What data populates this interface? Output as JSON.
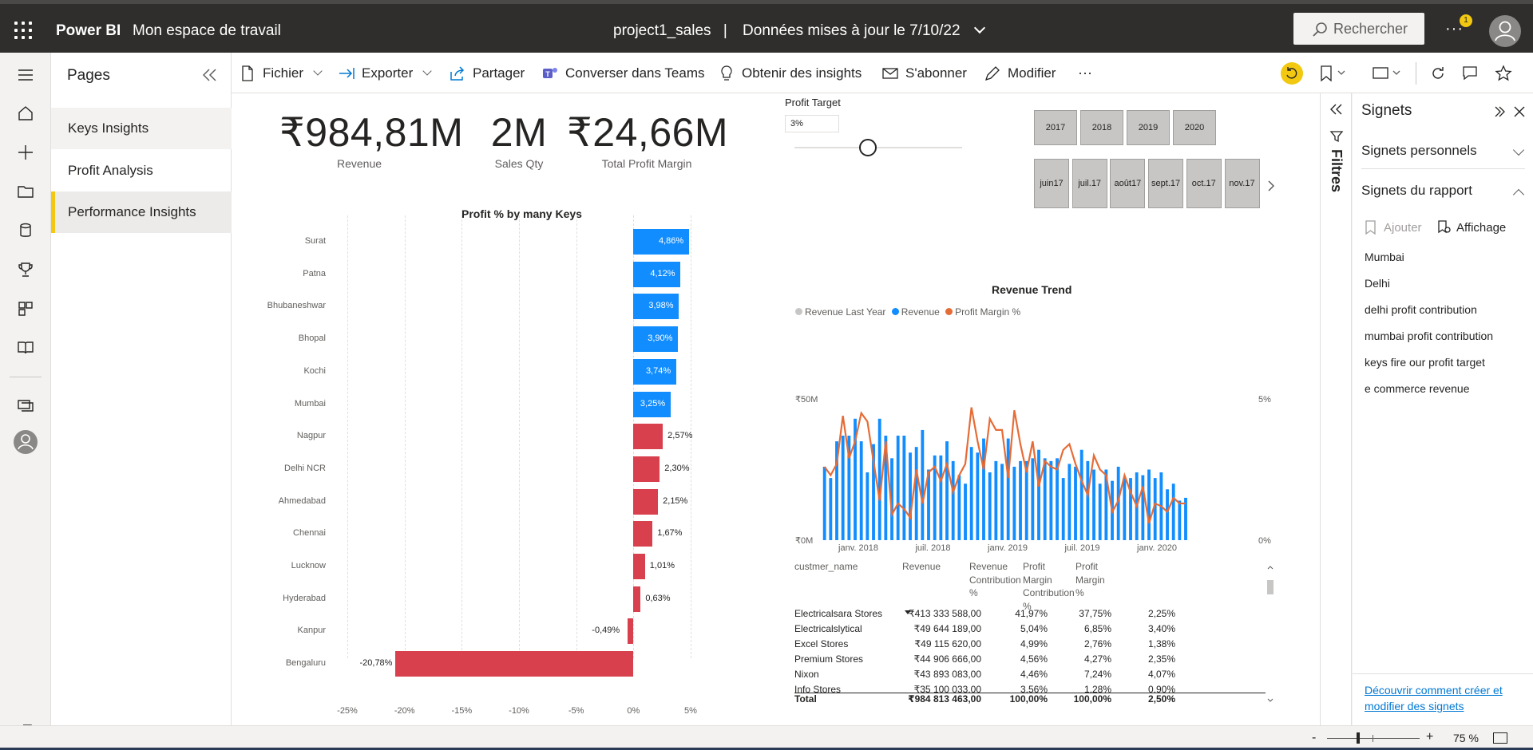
{
  "topbar": {
    "brand": "Power BI",
    "workspace": "Mon espace de travail",
    "report_name": "project1_sales",
    "separator": "|",
    "updated": "Données mises à jour le 7/10/22",
    "search_placeholder": "Rechercher",
    "more": "···",
    "notif_count": "1"
  },
  "pages": {
    "title": "Pages",
    "items": [
      {
        "label": "Keys Insights"
      },
      {
        "label": "Profit Analysis"
      },
      {
        "label": "Performance Insights"
      }
    ],
    "selected_index": 2
  },
  "actions": {
    "file": "Fichier",
    "export": "Exporter",
    "share": "Partager",
    "teams": "Converser dans Teams",
    "insights": "Obtenir des insights",
    "subscribe": "S'abonner",
    "edit": "Modifier",
    "more": "···"
  },
  "kpis": [
    {
      "value": "₹984,81M",
      "label": "Revenue"
    },
    {
      "value": "2M",
      "label": "Sales Qty"
    },
    {
      "value": "₹24,66M",
      "label": "Total Profit Margin"
    }
  ],
  "profit_target": {
    "title": "Profit Target",
    "value": "3%",
    "slider_fraction": 0.44
  },
  "year_tiles": [
    "2017",
    "2018",
    "2019",
    "2020"
  ],
  "month_tiles": [
    {
      "m": "juin",
      "y": "17"
    },
    {
      "m": "juil.",
      "y": "17"
    },
    {
      "m": "août",
      "y": "17"
    },
    {
      "m": "sept.",
      "y": "17"
    },
    {
      "m": "oct.",
      "y": "17"
    },
    {
      "m": "nov.",
      "y": "17"
    }
  ],
  "chart_data": [
    {
      "type": "bar",
      "title": "Profit % by many Keys",
      "orientation": "horizontal",
      "categories": [
        "Surat",
        "Patna",
        "Bhubaneshwar",
        "Bhopal",
        "Kochi",
        "Mumbai",
        "Nagpur",
        "Delhi NCR",
        "Ahmedabad",
        "Chennai",
        "Lucknow",
        "Hyderabad",
        "Kanpur",
        "Bengaluru"
      ],
      "values": [
        4.86,
        4.12,
        3.98,
        3.9,
        3.74,
        3.25,
        2.57,
        2.3,
        2.15,
        1.67,
        1.01,
        0.63,
        -0.49,
        -20.78
      ],
      "labels": [
        "4,86%",
        "4,12%",
        "3,98%",
        "3,90%",
        "3,74%",
        "3,25%",
        "2,57%",
        "2,30%",
        "2,15%",
        "1,67%",
        "1,01%",
        "0,63%",
        "-0,49%",
        "-20,78%"
      ],
      "above_target": [
        true,
        true,
        true,
        true,
        true,
        true,
        false,
        false,
        false,
        false,
        false,
        false,
        false,
        false
      ],
      "colors": {
        "above": "#118dff",
        "below": "#d9404e"
      },
      "xlim": [
        -25,
        5
      ],
      "xticks": [
        "-25%",
        "-20%",
        "-15%",
        "-10%",
        "-5%",
        "0%",
        "5%"
      ]
    },
    {
      "type": "bar+line",
      "title": "Revenue Trend",
      "legend": [
        "Revenue Last Year",
        "Revenue",
        "Profit Margin %"
      ],
      "legend_colors": [
        "#c8c6c4",
        "#118dff",
        "#e66c37"
      ],
      "y_left_ticks": [
        "₹50M",
        "₹0M"
      ],
      "y_right_ticks": [
        "5%",
        "0%"
      ],
      "x_ticks": [
        "janv. 2018",
        "juil. 2018",
        "janv. 2019",
        "juil. 2019",
        "janv. 2020"
      ],
      "ylim_left": [
        0,
        50
      ],
      "ylim_right": [
        0,
        5
      ],
      "revenue_last_year": [
        0,
        0,
        0,
        0,
        0,
        0,
        0,
        0,
        0,
        0,
        0,
        0,
        0,
        0,
        0,
        0,
        0,
        0,
        0,
        0,
        0,
        0,
        0,
        0,
        0,
        0,
        0,
        0,
        0,
        0,
        0,
        0,
        0,
        0,
        0,
        0,
        0,
        0,
        0,
        0,
        0,
        0,
        0,
        0,
        0,
        0,
        0,
        0,
        0,
        0,
        0,
        0,
        0,
        0,
        0,
        0,
        0,
        0,
        0,
        0
      ],
      "revenue": [
        26,
        22,
        35,
        37,
        37,
        43,
        35,
        24,
        34,
        43,
        37,
        29,
        37,
        37,
        31,
        33,
        39,
        25,
        30,
        30,
        35,
        28,
        23,
        20,
        33,
        31,
        36,
        24,
        28,
        27,
        36,
        26,
        28,
        28,
        29,
        32,
        29,
        28,
        29,
        22,
        27,
        26,
        32,
        28,
        25,
        20,
        25,
        21,
        26,
        22,
        22,
        24,
        23,
        25,
        22,
        24,
        18,
        20,
        14,
        15
      ],
      "profit_margin_pct": [
        2.6,
        2.3,
        2.7,
        4.4,
        2.9,
        3.5,
        4.5,
        4.2,
        2.8,
        1.4,
        3.5,
        0.9,
        1.3,
        1.1,
        0.8,
        2.5,
        1.3,
        2.4,
        2.6,
        2.1,
        2.7,
        1.7,
        2.3,
        2.7,
        4.7,
        3.5,
        2.5,
        4.3,
        3.9,
        3.9,
        2.2,
        4.6,
        3.4,
        2.4,
        3.5,
        1.9,
        2.8,
        2.6,
        2.5,
        3.2,
        3.4,
        2.7,
        2.1,
        1.6,
        3.0,
        2.5,
        2.3,
        1.0,
        1.4,
        2.3,
        1.7,
        1.2,
        1.9,
        0.6,
        1.3,
        1.2,
        1.0,
        1.5,
        1.3,
        1.3
      ]
    }
  ],
  "table": {
    "headers": [
      "custmer_name",
      "Revenue",
      "Revenue Contribution %",
      "Profit Margin Contribution %",
      "Profit Margin %"
    ],
    "rows": [
      [
        "Electricalsara Stores",
        "₹413 333 588,00",
        "41,97%",
        "37,75%",
        "2,25%"
      ],
      [
        "Electricalslytical",
        "₹49 644 189,00",
        "5,04%",
        "6,85%",
        "3,40%"
      ],
      [
        "Excel Stores",
        "₹49 115 620,00",
        "4,99%",
        "2,76%",
        "1,38%"
      ],
      [
        "Premium Stores",
        "₹44 906 666,00",
        "4,56%",
        "4,27%",
        "2,35%"
      ],
      [
        "Nixon",
        "₹43 893 083,00",
        "4,46%",
        "7,24%",
        "4,07%"
      ],
      [
        "Info Stores",
        "₹35 100 033,00",
        "3,56%",
        "1,28%",
        "0,90%"
      ]
    ],
    "total": [
      "Total",
      "₹984 813 463,00",
      "100,00%",
      "100,00%",
      "2,50%"
    ]
  },
  "filters": {
    "label": "Filtres"
  },
  "bookmarks": {
    "title": "Signets",
    "personal": "Signets personnels",
    "report": "Signets du rapport",
    "add": "Ajouter",
    "view": "Affichage",
    "items": [
      "Mumbai",
      "Delhi",
      "delhi profit contribution",
      "mumbai profit contribution",
      "keys fire our profit target",
      "e commerce revenue"
    ],
    "learn_link": "Découvrir comment créer et modifier des signets"
  },
  "status": {
    "zoom": "75 %",
    "zoom_fraction": 0.32
  }
}
